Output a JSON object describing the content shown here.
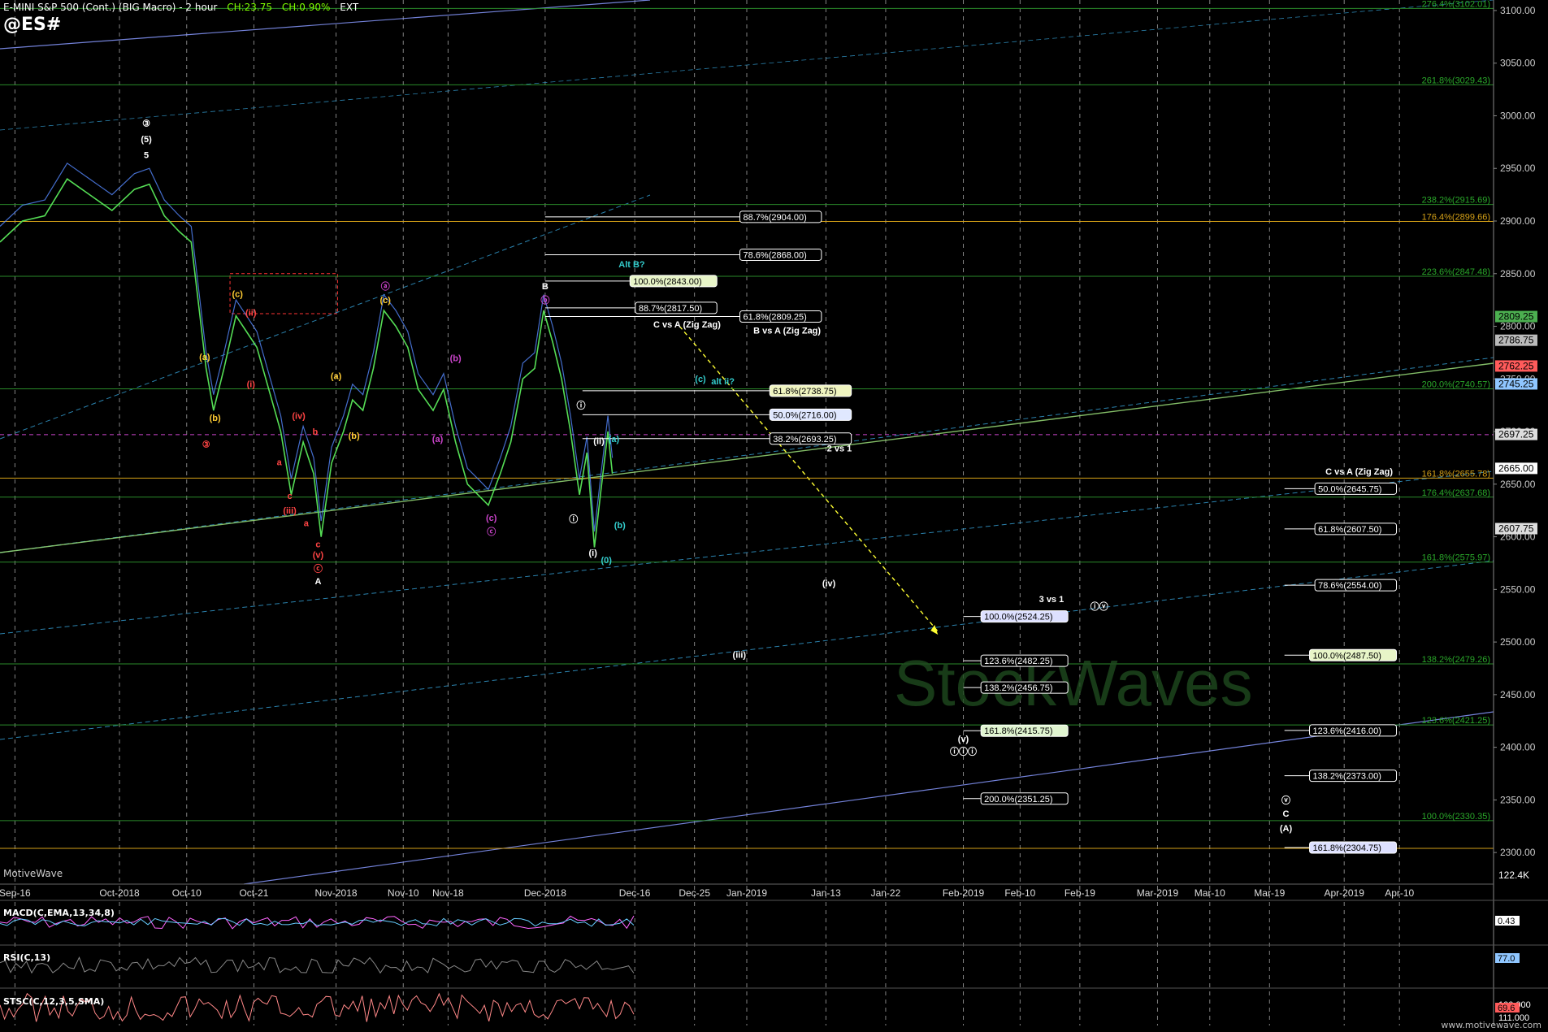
{
  "header": {
    "title": "E-MINI S&P 500 (Cont.) (BIG Macro) - 2 hour",
    "change": "CH:23.75",
    "change_pct": "CH:0.90%",
    "session": "EXT",
    "symbol": "@ES#",
    "brand": "MotiveWave",
    "website": "www.motivewave.com",
    "watermark": "StockWaves"
  },
  "chart_data": {
    "type": "line",
    "ylim": [
      2270,
      3110
    ],
    "price_ticks": [
      3100,
      3050,
      3000,
      2950,
      2900,
      2850,
      2800,
      2750,
      2700,
      2650,
      2600,
      2550,
      2500,
      2450,
      2400,
      2350,
      2300
    ],
    "date_ticks": [
      {
        "label": "Sep-16",
        "x": 0.01
      },
      {
        "label": "Oct-2018",
        "x": 0.08
      },
      {
        "label": "Oct-10",
        "x": 0.125
      },
      {
        "label": "Oct-21",
        "x": 0.17
      },
      {
        "label": "Nov-2018",
        "x": 0.225
      },
      {
        "label": "Nov-10",
        "x": 0.27
      },
      {
        "label": "Nov-18",
        "x": 0.3
      },
      {
        "label": "Dec-2018",
        "x": 0.365
      },
      {
        "label": "Dec-16",
        "x": 0.425
      },
      {
        "label": "Dec-25",
        "x": 0.465
      },
      {
        "label": "Jan-2019",
        "x": 0.5
      },
      {
        "label": "Jan-13",
        "x": 0.553
      },
      {
        "label": "Jan-22",
        "x": 0.593
      },
      {
        "label": "Feb-2019",
        "x": 0.645
      },
      {
        "label": "Feb-10",
        "x": 0.683
      },
      {
        "label": "Feb-19",
        "x": 0.723
      },
      {
        "label": "Mar-2019",
        "x": 0.775
      },
      {
        "label": "Mar-10",
        "x": 0.81
      },
      {
        "label": "Mar-19",
        "x": 0.85
      },
      {
        "label": "Apr-2019",
        "x": 0.9
      },
      {
        "label": "Apr-10",
        "x": 0.937
      }
    ],
    "price_path": [
      [
        0.0,
        2880
      ],
      [
        0.015,
        2900
      ],
      [
        0.03,
        2905
      ],
      [
        0.045,
        2940
      ],
      [
        0.06,
        2925
      ],
      [
        0.075,
        2910
      ],
      [
        0.09,
        2930
      ],
      [
        0.1,
        2935
      ],
      [
        0.11,
        2905
      ],
      [
        0.12,
        2890
      ],
      [
        0.128,
        2880
      ],
      [
        0.133,
        2820
      ],
      [
        0.138,
        2760
      ],
      [
        0.143,
        2720
      ],
      [
        0.15,
        2760
      ],
      [
        0.158,
        2810
      ],
      [
        0.165,
        2795
      ],
      [
        0.172,
        2780
      ],
      [
        0.18,
        2740
      ],
      [
        0.188,
        2700
      ],
      [
        0.195,
        2640
      ],
      [
        0.203,
        2690
      ],
      [
        0.21,
        2660
      ],
      [
        0.215,
        2600
      ],
      [
        0.222,
        2670
      ],
      [
        0.23,
        2700
      ],
      [
        0.236,
        2730
      ],
      [
        0.243,
        2720
      ],
      [
        0.25,
        2760
      ],
      [
        0.257,
        2815
      ],
      [
        0.265,
        2800
      ],
      [
        0.273,
        2780
      ],
      [
        0.28,
        2740
      ],
      [
        0.29,
        2720
      ],
      [
        0.297,
        2740
      ],
      [
        0.305,
        2690
      ],
      [
        0.313,
        2650
      ],
      [
        0.32,
        2640
      ],
      [
        0.327,
        2630
      ],
      [
        0.335,
        2660
      ],
      [
        0.342,
        2690
      ],
      [
        0.35,
        2750
      ],
      [
        0.358,
        2760
      ],
      [
        0.364,
        2815
      ],
      [
        0.37,
        2785
      ],
      [
        0.376,
        2750
      ],
      [
        0.382,
        2700
      ],
      [
        0.388,
        2640
      ],
      [
        0.393,
        2680
      ],
      [
        0.398,
        2590
      ],
      [
        0.402,
        2640
      ],
      [
        0.407,
        2700
      ],
      [
        0.41,
        2660
      ]
    ],
    "fib_boxes": [
      {
        "label": "88.7%(2904.00)",
        "price": 2904,
        "x0": 0.365,
        "x1": 0.55,
        "fg": "#fff",
        "bg": "#000",
        "border": "#fff"
      },
      {
        "label": "78.6%(2868.00)",
        "price": 2868,
        "x0": 0.365,
        "x1": 0.55,
        "fg": "#fff",
        "bg": "#000",
        "border": "#fff"
      },
      {
        "label": "100.0%(2843.00)",
        "price": 2843,
        "x0": 0.365,
        "x1": 0.48,
        "fg": "#000",
        "bg": "#e8f5c8",
        "border": "#fff"
      },
      {
        "label": "88.7%(2817.50)",
        "price": 2817.5,
        "x0": 0.365,
        "x1": 0.48,
        "fg": "#fff",
        "bg": "#000",
        "border": "#fff"
      },
      {
        "label": "61.8%(2809.25)",
        "price": 2809.25,
        "x0": 0.365,
        "x1": 0.55,
        "fg": "#fff",
        "bg": "#000",
        "border": "#fff"
      },
      {
        "label": "61.8%(2738.75)",
        "price": 2738.75,
        "x0": 0.39,
        "x1": 0.57,
        "fg": "#000",
        "bg": "#f0f5c0",
        "border": "#fff"
      },
      {
        "label": "50.0%(2716.00)",
        "price": 2716,
        "x0": 0.39,
        "x1": 0.57,
        "fg": "#000",
        "bg": "#e0e8ff",
        "border": "#fff"
      },
      {
        "label": "38.2%(2693.25)",
        "price": 2693.25,
        "x0": 0.39,
        "x1": 0.57,
        "fg": "#fff",
        "bg": "#000",
        "border": "#fff"
      },
      {
        "label": "100.0%(2524.25)",
        "price": 2524.25,
        "x0": 0.645,
        "x1": 0.715,
        "fg": "#000",
        "bg": "#dde0ff",
        "border": "#fff"
      },
      {
        "label": "123.6%(2482.25)",
        "price": 2482.25,
        "x0": 0.645,
        "x1": 0.715,
        "fg": "#fff",
        "bg": "#000",
        "border": "#fff"
      },
      {
        "label": "138.2%(2456.75)",
        "price": 2456.75,
        "x0": 0.645,
        "x1": 0.715,
        "fg": "#fff",
        "bg": "#000",
        "border": "#fff"
      },
      {
        "label": "161.8%(2415.75)",
        "price": 2415.75,
        "x0": 0.645,
        "x1": 0.715,
        "fg": "#000",
        "bg": "#e0f5d0",
        "border": "#fff"
      },
      {
        "label": "200.0%(2351.25)",
        "price": 2351.25,
        "x0": 0.645,
        "x1": 0.715,
        "fg": "#fff",
        "bg": "#000",
        "border": "#fff"
      },
      {
        "label": "50.0%(2645.75)",
        "price": 2645.75,
        "x0": 0.86,
        "x1": 0.935,
        "fg": "#fff",
        "bg": "#000",
        "border": "#fff"
      },
      {
        "label": "61.8%(2607.50)",
        "price": 2607.5,
        "x0": 0.86,
        "x1": 0.935,
        "fg": "#fff",
        "bg": "#000",
        "border": "#fff"
      },
      {
        "label": "78.6%(2554.00)",
        "price": 2554,
        "x0": 0.86,
        "x1": 0.935,
        "fg": "#fff",
        "bg": "#000",
        "border": "#fff"
      },
      {
        "label": "100.0%(2487.50)",
        "price": 2487.5,
        "x0": 0.86,
        "x1": 0.935,
        "fg": "#000",
        "bg": "#e8f5c8",
        "border": "#fff"
      },
      {
        "label": "123.6%(2416.00)",
        "price": 2416,
        "x0": 0.86,
        "x1": 0.935,
        "fg": "#fff",
        "bg": "#000",
        "border": "#fff"
      },
      {
        "label": "138.2%(2373.00)",
        "price": 2373,
        "x0": 0.86,
        "x1": 0.935,
        "fg": "#fff",
        "bg": "#000",
        "border": "#fff"
      },
      {
        "label": "161.8%(2304.75)",
        "price": 2304.75,
        "x0": 0.86,
        "x1": 0.935,
        "fg": "#000",
        "bg": "#dde0ff",
        "border": "#fff"
      }
    ],
    "green_levels": [
      {
        "label": "276.4%(3102.01)",
        "price": 3102.01
      },
      {
        "label": "261.8%(3029.43)",
        "price": 3029.43
      },
      {
        "label": "238.2%(2915.69)",
        "price": 2915.69
      },
      {
        "label": "223.6%(2847.48)",
        "price": 2847.48
      },
      {
        "label": "200.0%(2740.57)",
        "price": 2740.57
      },
      {
        "label": "176.4%(2637.68)",
        "price": 2637.68
      },
      {
        "label": "161.8%(2575.97)",
        "price": 2575.97
      },
      {
        "label": "138.2%(2479.26)",
        "price": 2479.26
      },
      {
        "label": "123.6%(2421.25)",
        "price": 2421.25
      },
      {
        "label": "100.0%(2330.35)",
        "price": 2330.35
      }
    ],
    "orange_levels": [
      {
        "label": "176.4%(2899.66)",
        "price": 2899.66
      },
      {
        "label": "161.8%(2655.78)",
        "price": 2655.78
      },
      {
        "label": "",
        "price": 2304
      }
    ],
    "price_tags": [
      {
        "text": "2809.25",
        "price": 2809.25,
        "bg": "#4caf50",
        "fg": "#000"
      },
      {
        "text": "2786.75",
        "price": 2786.75,
        "bg": "#bbb",
        "fg": "#000"
      },
      {
        "text": "2762.25",
        "price": 2762.25,
        "bg": "#ff5b5b",
        "fg": "#000"
      },
      {
        "text": "2745.25",
        "price": 2745.25,
        "bg": "#8fc6ff",
        "fg": "#000"
      },
      {
        "text": "2697.25",
        "price": 2697.25,
        "bg": "#ddd",
        "fg": "#000"
      },
      {
        "text": "2665.00",
        "price": 2665,
        "bg": "#fff",
        "fg": "#000"
      },
      {
        "text": "2607.75",
        "price": 2607.75,
        "bg": "#ddd",
        "fg": "#000"
      }
    ],
    "wave_labels": [
      {
        "text": "③",
        "x": 0.098,
        "price": 2990,
        "color": "#fff"
      },
      {
        "text": "(5)",
        "x": 0.098,
        "price": 2975,
        "color": "#fff"
      },
      {
        "text": "5",
        "x": 0.098,
        "price": 2960,
        "color": "#fff"
      },
      {
        "text": "(a)",
        "x": 0.137,
        "price": 2768,
        "color": "#ffcc33"
      },
      {
        "text": "(b)",
        "x": 0.144,
        "price": 2710,
        "color": "#ffcc33"
      },
      {
        "text": "③",
        "x": 0.138,
        "price": 2685,
        "color": "#ff4444"
      },
      {
        "text": "(c)",
        "x": 0.159,
        "price": 2828,
        "color": "#ffcc33"
      },
      {
        "text": "(ii)",
        "x": 0.168,
        "price": 2810,
        "color": "#ff4444"
      },
      {
        "text": "(i)",
        "x": 0.168,
        "price": 2742,
        "color": "#ff4444"
      },
      {
        "text": "(iv)",
        "x": 0.2,
        "price": 2712,
        "color": "#ff4444"
      },
      {
        "text": "b",
        "x": 0.211,
        "price": 2697,
        "color": "#ff4444"
      },
      {
        "text": "a",
        "x": 0.187,
        "price": 2668,
        "color": "#ff4444"
      },
      {
        "text": "c",
        "x": 0.194,
        "price": 2636,
        "color": "#ff4444"
      },
      {
        "text": "(iii)",
        "x": 0.194,
        "price": 2622,
        "color": "#ff4444"
      },
      {
        "text": "a",
        "x": 0.205,
        "price": 2610,
        "color": "#ff4444"
      },
      {
        "text": "c",
        "x": 0.213,
        "price": 2590,
        "color": "#ff4444"
      },
      {
        "text": "(v)",
        "x": 0.213,
        "price": 2580,
        "color": "#ff4444"
      },
      {
        "text": "ⓒ",
        "x": 0.213,
        "price": 2567,
        "color": "#ff4444"
      },
      {
        "text": "A",
        "x": 0.213,
        "price": 2555,
        "color": "#fff"
      },
      {
        "text": "(a)",
        "x": 0.225,
        "price": 2750,
        "color": "#ffcc33"
      },
      {
        "text": "(b)",
        "x": 0.237,
        "price": 2693,
        "color": "#ffcc33"
      },
      {
        "text": "ⓐ",
        "x": 0.258,
        "price": 2835,
        "color": "#cc44cc"
      },
      {
        "text": "(c)",
        "x": 0.258,
        "price": 2822,
        "color": "#ffcc33"
      },
      {
        "text": "(b)",
        "x": 0.305,
        "price": 2767,
        "color": "#cc44cc"
      },
      {
        "text": "(a)",
        "x": 0.293,
        "price": 2690,
        "color": "#cc44cc"
      },
      {
        "text": "(c)",
        "x": 0.329,
        "price": 2615,
        "color": "#cc44cc"
      },
      {
        "text": "ⓒ",
        "x": 0.329,
        "price": 2602,
        "color": "#cc44cc"
      },
      {
        "text": "B",
        "x": 0.365,
        "price": 2835,
        "color": "#fff"
      },
      {
        "text": "ⓑ",
        "x": 0.365,
        "price": 2822,
        "color": "#cc44cc"
      },
      {
        "text": "ⓘ",
        "x": 0.389,
        "price": 2722,
        "color": "#fff"
      },
      {
        "text": "(ii)",
        "x": 0.401,
        "price": 2688,
        "color": "#fff"
      },
      {
        "text": "(a)",
        "x": 0.411,
        "price": 2690,
        "color": "#33cccc"
      },
      {
        "text": "ⓘ",
        "x": 0.384,
        "price": 2614,
        "color": "#fff"
      },
      {
        "text": "(b)",
        "x": 0.415,
        "price": 2608,
        "color": "#33cccc"
      },
      {
        "text": "(i)",
        "x": 0.397,
        "price": 2582,
        "color": "#fff"
      },
      {
        "text": "(0)",
        "x": 0.406,
        "price": 2575,
        "color": "#33cccc"
      },
      {
        "text": "(c)",
        "x": 0.469,
        "price": 2747,
        "color": "#33cccc"
      },
      {
        "text": "alt ii?",
        "x": 0.484,
        "price": 2745,
        "color": "#33cccc"
      },
      {
        "text": "Alt B?",
        "x": 0.423,
        "price": 2856,
        "color": "#33cccc"
      },
      {
        "text": "C vs A (Zig Zag)",
        "x": 0.46,
        "price": 2799,
        "color": "#fff"
      },
      {
        "text": "B vs A (Zig Zag)",
        "x": 0.527,
        "price": 2793,
        "color": "#fff"
      },
      {
        "text": "2 vs 1",
        "x": 0.562,
        "price": 2681,
        "color": "#fff"
      },
      {
        "text": "(iv)",
        "x": 0.555,
        "price": 2553,
        "color": "#fff"
      },
      {
        "text": "(iii)",
        "x": 0.495,
        "price": 2485,
        "color": "#fff"
      },
      {
        "text": "3 vs 1",
        "x": 0.704,
        "price": 2538,
        "color": "#fff"
      },
      {
        "text": "ⓘⓥ",
        "x": 0.736,
        "price": 2531,
        "color": "#fff"
      },
      {
        "text": "(v)",
        "x": 0.645,
        "price": 2405,
        "color": "#fff"
      },
      {
        "text": "ⓘⓘⓘ",
        "x": 0.645,
        "price": 2393,
        "color": "#fff"
      },
      {
        "text": "C vs A (Zig Zag)",
        "x": 0.91,
        "price": 2659,
        "color": "#fff"
      },
      {
        "text": "ⓥ",
        "x": 0.861,
        "price": 2347,
        "color": "#fff"
      },
      {
        "text": "C",
        "x": 0.861,
        "price": 2334,
        "color": "#fff"
      },
      {
        "text": "(A)",
        "x": 0.861,
        "price": 2320,
        "color": "#fff"
      }
    ],
    "indicators": {
      "macd": {
        "label": "MACD(C,EMA,13,34,8)",
        "value": "0.43"
      },
      "rsi": {
        "label": "RSI(C,13)",
        "value": "77.0"
      },
      "stoch": {
        "label": "STSC(C,12,3,5,SMA)",
        "value": "69.6"
      },
      "volume": "122.4K",
      "stoch_hi": "100.000",
      "stoch_lo": "111.000"
    }
  }
}
